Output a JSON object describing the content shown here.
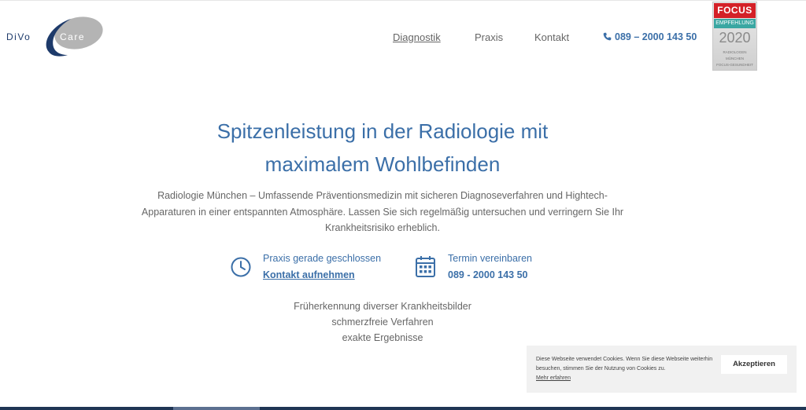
{
  "brand": {
    "logo_left": "DiVo",
    "logo_right": "Care",
    "colors": {
      "primary": "#3b6fa8",
      "logo_gray": "#b4b4b4",
      "logo_navy": "#1d3a6a"
    }
  },
  "nav": {
    "items": [
      {
        "label": "Diagnostik",
        "active": true
      },
      {
        "label": "Praxis"
      },
      {
        "label": "Kontakt"
      }
    ],
    "phone": {
      "icon": "phone-icon",
      "label": "089 – 2000 143 50"
    }
  },
  "badge": {
    "brand": "FOCUS",
    "line1": "EMPFEHLUNG",
    "year": "2020",
    "category": "RADIOLOGEN",
    "city": "MÜNCHEN",
    "footer": "FOCUS-GESUNDHEIT",
    "colors": {
      "red": "#d42027",
      "teal": "#3aa7a2"
    }
  },
  "hero": {
    "title_line1": "Spitzenleistung in der Radiologie mit",
    "title_line2": "maximalem Wohlbefinden",
    "lead": "Radiologie München – Umfassende Präventionsmedizin mit sicheren Diagnoseverfahren und Hightech-Apparaturen in einer entspannten Atmosphäre. Lassen Sie sich regelmäßig untersuchen und verringern Sie Ihr Krankheitsrisiko erheblich."
  },
  "info": {
    "opening": {
      "icon": "clock-icon",
      "status": "Praxis gerade geschlossen",
      "link": "Kontakt aufnehmen"
    },
    "appointment": {
      "icon": "calendar-icon",
      "label": "Termin vereinbaren",
      "phone": "089 - 2000 143 50"
    }
  },
  "features": [
    "Früherkennung diverser Krankheitsbilder",
    "schmerzfreie Verfahren",
    "exakte Ergebnisse"
  ],
  "cookie": {
    "text": "Diese Webseite verwendet Cookies. Wenn Sie diese Webseite weiterhin besuchen, stimmen Sie der Nutzung von Cookies zu.",
    "more_link": "Mehr erfahren",
    "accept_label": "Akzeptieren"
  }
}
